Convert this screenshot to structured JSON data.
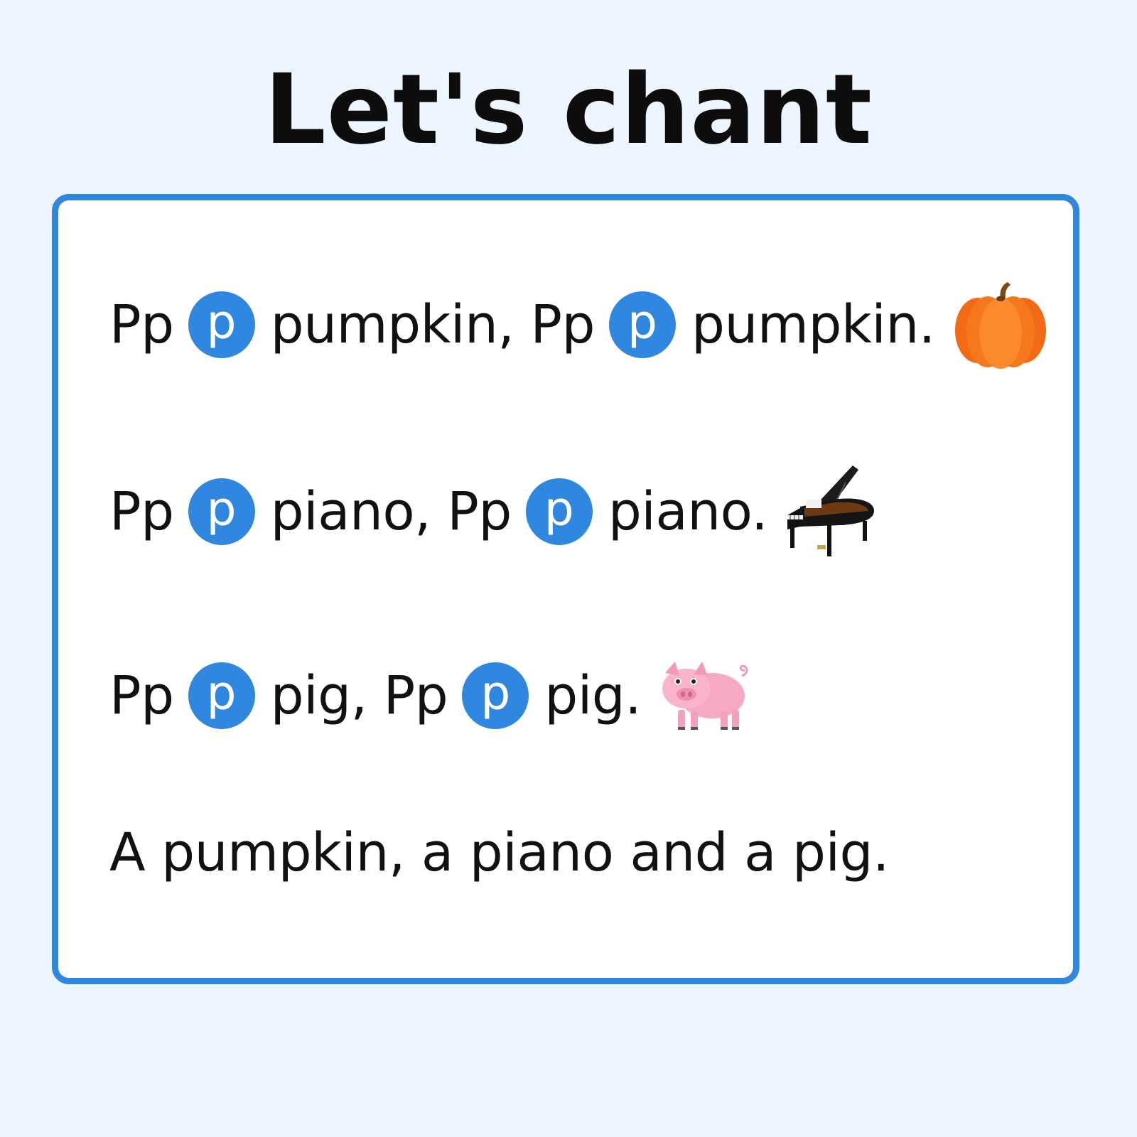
{
  "title": "Let's chant",
  "colors": {
    "accent": "#2f87e0",
    "background": "#edf5fe",
    "card": "#ffffff"
  },
  "lines": [
    {
      "letters_1": "Pp",
      "badge_1": "p",
      "word_1": "pumpkin, Pp",
      "badge_2": "p",
      "word_2": "pumpkin.",
      "icon": "pumpkin-icon"
    },
    {
      "letters_1": "Pp",
      "badge_1": "p",
      "word_1": "piano, Pp",
      "badge_2": "p",
      "word_2": "piano.",
      "icon": "piano-icon"
    },
    {
      "letters_1": "Pp",
      "badge_1": "p",
      "word_1": "pig, Pp",
      "badge_2": "p",
      "word_2": "pig.",
      "icon": "pig-icon"
    },
    {
      "text": "A pumpkin, a piano and a pig."
    }
  ]
}
